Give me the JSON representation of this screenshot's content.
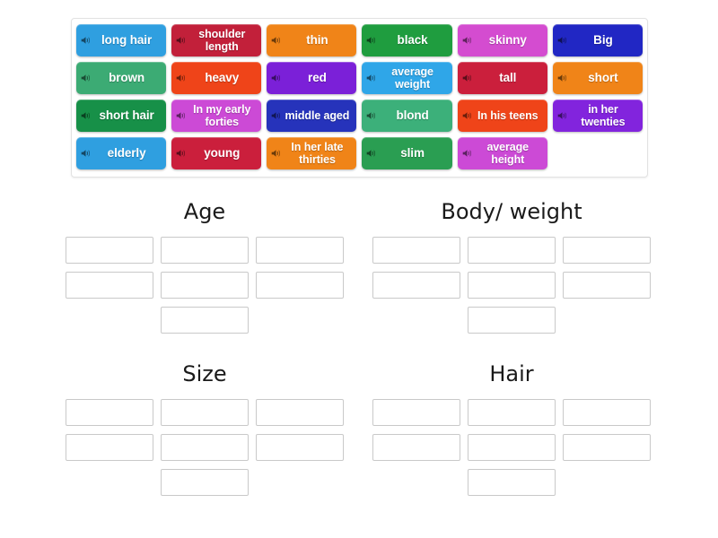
{
  "activity": {
    "type": "group-sort",
    "tile_count": 23,
    "audio_icon": "speaker-icon"
  },
  "word_bank": {
    "name": "word-bank",
    "tiles": [
      {
        "label": "long hair",
        "color": "#2f9fe0",
        "lines": 1,
        "audio": true
      },
      {
        "label": "shoulder length",
        "color": "#c2203a",
        "lines": 2,
        "audio": true
      },
      {
        "label": "thin",
        "color": "#f08418",
        "lines": 1,
        "audio": true
      },
      {
        "label": "black",
        "color": "#1f9d3f",
        "lines": 1,
        "audio": true
      },
      {
        "label": "skinny",
        "color": "#d44cd0",
        "lines": 1,
        "audio": true
      },
      {
        "label": "Big",
        "color": "#2127c4",
        "lines": 1,
        "audio": true
      },
      {
        "label": "brown",
        "color": "#3cab74",
        "lines": 1,
        "audio": true
      },
      {
        "label": "heavy",
        "color": "#ef4419",
        "lines": 1,
        "audio": true
      },
      {
        "label": "red",
        "color": "#7b20d8",
        "lines": 1,
        "audio": true
      },
      {
        "label": "average weight",
        "color": "#2fa6e8",
        "lines": 2,
        "audio": true
      },
      {
        "label": "tall",
        "color": "#cb1f3c",
        "lines": 1,
        "audio": true
      },
      {
        "label": "short",
        "color": "#f08418",
        "lines": 1,
        "audio": true
      },
      {
        "label": "short hair",
        "color": "#179048",
        "lines": 1,
        "audio": true
      },
      {
        "label": "In my early forties",
        "color": "#cc4ad6",
        "lines": 2,
        "audio": true
      },
      {
        "label": "middle aged",
        "color": "#2633bb",
        "lines": 2,
        "audio": true
      },
      {
        "label": "blond",
        "color": "#3cb07a",
        "lines": 1,
        "audio": true
      },
      {
        "label": "In his teens",
        "color": "#ef4419",
        "lines": 2,
        "audio": true
      },
      {
        "label": "in her twenties",
        "color": "#8224dd",
        "lines": 2,
        "audio": true
      },
      {
        "label": "elderly",
        "color": "#2f9fe0",
        "lines": 1,
        "audio": true
      },
      {
        "label": "young",
        "color": "#cb1f3c",
        "lines": 1,
        "audio": true
      },
      {
        "label": "In her late thirties",
        "color": "#f08418",
        "lines": 2,
        "audio": true
      },
      {
        "label": "slim",
        "color": "#2a9e52",
        "lines": 1,
        "audio": true
      },
      {
        "label": "average height",
        "color": "#cc4ad6",
        "lines": 2,
        "audio": true
      }
    ]
  },
  "groups": [
    {
      "id": "age",
      "title": "Age",
      "slots": 7
    },
    {
      "id": "body",
      "title": "Body/ weight",
      "slots": 7
    },
    {
      "id": "size",
      "title": "Size",
      "slots": 7
    },
    {
      "id": "hair",
      "title": "Hair",
      "slots": 7
    }
  ]
}
